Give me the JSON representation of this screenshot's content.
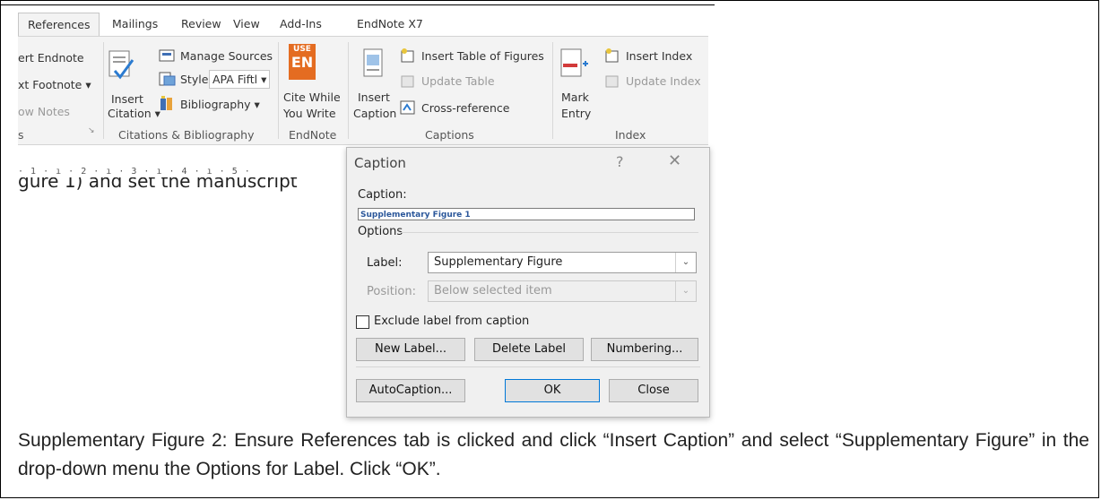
{
  "ribbon": {
    "tabs": [
      "References",
      "Mailings",
      "Review",
      "View",
      "Add-Ins",
      "EndNote X7"
    ],
    "footnotes": {
      "insert_endnote": "ert Endnote",
      "next_footnote": "xt Footnote ▾",
      "show_notes": "ow Notes",
      "group_label": "s"
    },
    "citations": {
      "insert_citation": "Insert",
      "insert_citation_2": "Citation ▾",
      "manage_sources": "Manage Sources",
      "style_label": "Style:",
      "style_value": "APA Fiftl ▾",
      "bibliography": "Bibliography ▾",
      "group_label": "Citations & Bibliography"
    },
    "endnote": {
      "icon_top": "USE",
      "icon_bottom": "EN",
      "cite_while": "Cite While",
      "you_write": "You Write",
      "group_label": "EndNote"
    },
    "captions": {
      "insert_caption": "Insert",
      "insert_caption_2": "Caption",
      "insert_table_of_figures": "Insert Table of Figures",
      "update_table": "Update Table",
      "cross_reference": "Cross-reference",
      "group_label": "Captions"
    },
    "index": {
      "mark_entry": "Mark",
      "mark_entry_2": "Entry",
      "insert_index": "Insert Index",
      "update_index": "Update Index",
      "group_label": "Index"
    }
  },
  "ruler": "· 1 · ı · 2 · ı · 3 · ı · 4 · ı · 5 ·",
  "document_text": "gure 1) and set the manuscript",
  "dialog": {
    "title": "Caption",
    "help": "?",
    "close": "✕",
    "caption_label": "Caption:",
    "caption_value": "Supplementary Figure 1",
    "options_label": "Options",
    "label_label": "Label:",
    "label_value": "Supplementary Figure",
    "position_label": "Position:",
    "position_value": "Below selected item",
    "exclude_label": "Exclude label from caption",
    "new_label_button": "New Label...",
    "delete_label_button": "Delete Label",
    "numbering_button": "Numbering...",
    "autocaption_button": "AutoCaption...",
    "ok_button": "OK",
    "close_button": "Close"
  },
  "figure_caption": "Supplementary Figure 2: Ensure References tab is clicked and click “Insert Caption” and select “Supplementary Figure” in the drop-down menu the Options for Label. Click “OK”.",
  "colors": {
    "endnote_orange": "#e46c21",
    "accent_blue": "#2b579a",
    "ribbon_bg": "#f3f3f3"
  }
}
